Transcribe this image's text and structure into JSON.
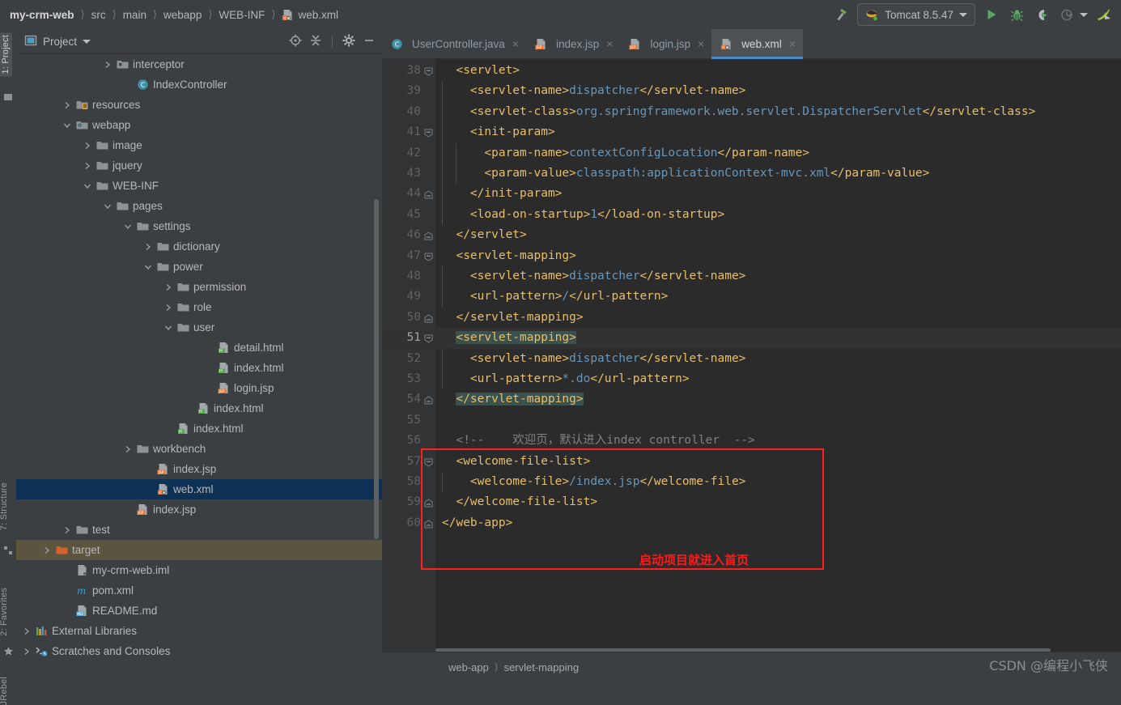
{
  "window": {
    "breadcrumb": [
      {
        "label": "my-crm-web",
        "root": true
      },
      {
        "label": "src"
      },
      {
        "label": "main"
      },
      {
        "label": "webapp"
      },
      {
        "label": "WEB-INF"
      },
      {
        "label": "web.xml",
        "icon": "xml-file-icon"
      }
    ]
  },
  "toolbar": {
    "run_config": "Tomcat 8.5.47",
    "run_label": "Run",
    "debug_label": "Debug",
    "run_coverage_label": "Run with Coverage",
    "profile_label": "Profile",
    "jrebel_label": "Run with JRebel"
  },
  "left_strip": {
    "items": [
      {
        "label": "1: Project",
        "selected": true
      },
      {
        "label": "7: Structure",
        "selected": false
      },
      {
        "label": "2: Favorites",
        "selected": false
      },
      {
        "label": "JRebel",
        "selected": false
      }
    ]
  },
  "project_panel": {
    "title": "Project",
    "icons": [
      "locate-icon",
      "collapse-all-icon",
      "gear-icon",
      "minimize-icon"
    ],
    "tree": [
      {
        "label": "interceptor",
        "indent": 5,
        "arrow": "right",
        "icon": "package-folder-icon"
      },
      {
        "label": "IndexController",
        "indent": 6,
        "arrow": "none",
        "icon": "java-class-icon"
      },
      {
        "label": "resources",
        "indent": 3,
        "arrow": "right",
        "icon": "resources-folder-icon"
      },
      {
        "label": "webapp",
        "indent": 3,
        "arrow": "down",
        "icon": "webapp-folder-icon"
      },
      {
        "label": "image",
        "indent": 4,
        "arrow": "right",
        "icon": "folder-icon"
      },
      {
        "label": "jquery",
        "indent": 4,
        "arrow": "right",
        "icon": "folder-icon"
      },
      {
        "label": "WEB-INF",
        "indent": 4,
        "arrow": "down",
        "icon": "folder-icon"
      },
      {
        "label": "pages",
        "indent": 5,
        "arrow": "down",
        "icon": "folder-icon"
      },
      {
        "label": "settings",
        "indent": 6,
        "arrow": "down",
        "icon": "folder-icon"
      },
      {
        "label": "dictionary",
        "indent": 7,
        "arrow": "right",
        "icon": "folder-icon"
      },
      {
        "label": "power",
        "indent": 7,
        "arrow": "down",
        "icon": "folder-icon"
      },
      {
        "label": "permission",
        "indent": 8,
        "arrow": "right",
        "icon": "folder-icon"
      },
      {
        "label": "role",
        "indent": 8,
        "arrow": "right",
        "icon": "folder-icon"
      },
      {
        "label": "user",
        "indent": 8,
        "arrow": "down",
        "icon": "folder-icon"
      },
      {
        "label": "detail.html",
        "indent": 10,
        "arrow": "none",
        "icon": "html-file-icon"
      },
      {
        "label": "index.html",
        "indent": 10,
        "arrow": "none",
        "icon": "html-file-icon"
      },
      {
        "label": "login.jsp",
        "indent": 10,
        "arrow": "none",
        "icon": "jsp-file-icon"
      },
      {
        "label": "index.html",
        "indent": 9,
        "arrow": "none",
        "icon": "html-file-icon"
      },
      {
        "label": "index.html",
        "indent": 8,
        "arrow": "none",
        "icon": "html-file-icon"
      },
      {
        "label": "workbench",
        "indent": 6,
        "arrow": "right",
        "icon": "folder-icon"
      },
      {
        "label": "index.jsp",
        "indent": 7,
        "arrow": "none",
        "icon": "jsp-file-icon"
      },
      {
        "label": "web.xml",
        "indent": 7,
        "arrow": "none",
        "icon": "xml-file-icon",
        "state": "selected"
      },
      {
        "label": "index.jsp",
        "indent": 6,
        "arrow": "none",
        "icon": "jsp-file-icon"
      },
      {
        "label": "test",
        "indent": 3,
        "arrow": "right",
        "icon": "folder-icon"
      },
      {
        "label": "target",
        "indent": 2,
        "arrow": "right",
        "icon": "target-folder-icon",
        "state": "highlighted"
      },
      {
        "label": "my-crm-web.iml",
        "indent": 3,
        "arrow": "none",
        "icon": "iml-file-icon"
      },
      {
        "label": "pom.xml",
        "indent": 3,
        "arrow": "none",
        "icon": "maven-file-icon"
      },
      {
        "label": "README.md",
        "indent": 3,
        "arrow": "none",
        "icon": "md-file-icon"
      },
      {
        "label": "External Libraries",
        "indent": 1,
        "arrow": "right",
        "icon": "libraries-icon"
      },
      {
        "label": "Scratches and Consoles",
        "indent": 1,
        "arrow": "right",
        "icon": "scratches-icon"
      }
    ]
  },
  "editor": {
    "tabs": [
      {
        "label": "UserController.java",
        "icon": "java-class-icon",
        "active": false
      },
      {
        "label": "index.jsp",
        "icon": "jsp-file-icon",
        "active": false
      },
      {
        "label": "login.jsp",
        "icon": "jsp-file-icon",
        "active": false
      },
      {
        "label": "web.xml",
        "icon": "xml-file-icon",
        "active": true
      }
    ],
    "close_glyph": "×",
    "first_line_number": 38,
    "current_line": 51,
    "lines": [
      {
        "n": 38,
        "fold": "open",
        "indent": 1,
        "tokens": [
          {
            "t": "tag",
            "s": "<servlet>"
          }
        ]
      },
      {
        "n": 39,
        "fold": "",
        "indent": 2,
        "tokens": [
          {
            "t": "tag",
            "s": "<servlet-name>"
          },
          {
            "t": "val",
            "s": "dispatcher"
          },
          {
            "t": "tag",
            "s": "</servlet-name>"
          }
        ]
      },
      {
        "n": 40,
        "fold": "",
        "indent": 2,
        "tokens": [
          {
            "t": "tag",
            "s": "<servlet-class>"
          },
          {
            "t": "val",
            "s": "org.springframework.web.servlet.DispatcherServlet"
          },
          {
            "t": "tag",
            "s": "</servlet-class>"
          }
        ]
      },
      {
        "n": 41,
        "fold": "open",
        "indent": 2,
        "tokens": [
          {
            "t": "tag",
            "s": "<init-param>"
          }
        ]
      },
      {
        "n": 42,
        "fold": "",
        "indent": 3,
        "tokens": [
          {
            "t": "tag",
            "s": "<param-name>"
          },
          {
            "t": "val",
            "s": "contextConfigLocation"
          },
          {
            "t": "tag",
            "s": "</param-name>"
          }
        ]
      },
      {
        "n": 43,
        "fold": "",
        "indent": 3,
        "tokens": [
          {
            "t": "tag",
            "s": "<param-value>"
          },
          {
            "t": "val",
            "s": "classpath:applicationContext-mvc.xml"
          },
          {
            "t": "tag",
            "s": "</param-value>"
          }
        ]
      },
      {
        "n": 44,
        "fold": "close",
        "indent": 2,
        "tokens": [
          {
            "t": "tag",
            "s": "</init-param>"
          }
        ]
      },
      {
        "n": 45,
        "fold": "",
        "indent": 2,
        "tokens": [
          {
            "t": "tag",
            "s": "<load-on-startup>"
          },
          {
            "t": "num",
            "s": "1"
          },
          {
            "t": "tag",
            "s": "</load-on-startup>"
          }
        ]
      },
      {
        "n": 46,
        "fold": "close",
        "indent": 1,
        "tokens": [
          {
            "t": "tag",
            "s": "</servlet>"
          }
        ]
      },
      {
        "n": 47,
        "fold": "open",
        "indent": 1,
        "tokens": [
          {
            "t": "tag",
            "s": "<servlet-mapping>"
          }
        ]
      },
      {
        "n": 48,
        "fold": "",
        "indent": 2,
        "tokens": [
          {
            "t": "tag",
            "s": "<servlet-name>"
          },
          {
            "t": "val",
            "s": "dispatcher"
          },
          {
            "t": "tag",
            "s": "</servlet-name>"
          }
        ]
      },
      {
        "n": 49,
        "fold": "",
        "indent": 2,
        "tokens": [
          {
            "t": "tag",
            "s": "<url-pattern>"
          },
          {
            "t": "val",
            "s": "/"
          },
          {
            "t": "tag",
            "s": "</url-pattern>"
          }
        ]
      },
      {
        "n": 50,
        "fold": "close",
        "indent": 1,
        "tokens": [
          {
            "t": "tag",
            "s": "</servlet-mapping>"
          }
        ]
      },
      {
        "n": 51,
        "fold": "open",
        "indent": 1,
        "current": true,
        "tokens": [
          {
            "t": "tag",
            "s": "<servlet-mapping>",
            "match": true
          }
        ]
      },
      {
        "n": 52,
        "fold": "",
        "indent": 2,
        "tokens": [
          {
            "t": "tag",
            "s": "<servlet-name>"
          },
          {
            "t": "val",
            "s": "dispatcher"
          },
          {
            "t": "tag",
            "s": "</servlet-name>"
          }
        ]
      },
      {
        "n": 53,
        "fold": "",
        "indent": 2,
        "tokens": [
          {
            "t": "tag",
            "s": "<url-pattern>"
          },
          {
            "t": "val",
            "s": "*.do"
          },
          {
            "t": "tag",
            "s": "</url-pattern>"
          }
        ]
      },
      {
        "n": 54,
        "fold": "close",
        "indent": 1,
        "tokens": [
          {
            "t": "tag",
            "s": "</servlet-mapping>",
            "match": true
          }
        ]
      },
      {
        "n": 55,
        "fold": "",
        "indent": 0,
        "tokens": []
      },
      {
        "n": 56,
        "fold": "",
        "indent": 1,
        "tokens": [
          {
            "t": "cmt",
            "s": "<!--    欢迎页，默认进入index controller  -->"
          }
        ]
      },
      {
        "n": 57,
        "fold": "open",
        "indent": 1,
        "tokens": [
          {
            "t": "tag",
            "s": "<welcome-file-list>"
          }
        ]
      },
      {
        "n": 58,
        "fold": "",
        "indent": 2,
        "tokens": [
          {
            "t": "tag",
            "s": "<welcome-file>"
          },
          {
            "t": "val",
            "s": "/index.jsp"
          },
          {
            "t": "tag",
            "s": "</welcome-file>"
          }
        ]
      },
      {
        "n": 59,
        "fold": "close",
        "indent": 1,
        "tokens": [
          {
            "t": "tag",
            "s": "</welcome-file-list>"
          }
        ]
      },
      {
        "n": 60,
        "fold": "close",
        "indent": 0,
        "tokens": [
          {
            "t": "tag",
            "s": "</web-app>"
          }
        ]
      }
    ],
    "annotation": {
      "text": "启动项目就进入首页",
      "color": "#ff1a1a"
    },
    "breadcrumb": [
      "web-app",
      "servlet-mapping"
    ]
  },
  "watermark": "CSDN @编程小飞侠"
}
